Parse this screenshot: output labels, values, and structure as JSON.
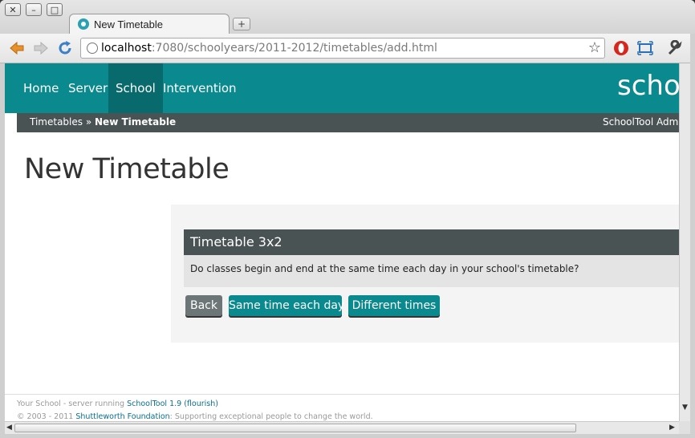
{
  "browser": {
    "tab_title": "New Timetable",
    "new_tab_label": "+",
    "window_controls": {
      "close": "✕",
      "minimize": "–",
      "maximize": "□"
    },
    "url_host": "localhost",
    "url_rest": ":7080/schoolyears/2011-2012/timetables/add.html"
  },
  "nav": {
    "items": [
      {
        "label": "Home"
      },
      {
        "label": "Server"
      },
      {
        "label": "School"
      },
      {
        "label": "Intervention"
      }
    ],
    "active": "School",
    "brand": "schoo",
    "accent_color": "#0a8a8f"
  },
  "breadcrumb": {
    "parent": "Timetables",
    "separator": "»",
    "current": "New Timetable",
    "user": "SchoolTool Administrator"
  },
  "page": {
    "title": "New Timetable"
  },
  "form": {
    "heading": "Timetable 3x2",
    "question": "Do classes begin and end at the same time each day in your school's timetable?",
    "buttons": {
      "back": "Back",
      "same": "Same time each day",
      "different": "Different times"
    }
  },
  "footer": {
    "line1_prefix": "Your School - server running ",
    "line1_link": "SchoolTool 1.9 (flourish)",
    "line2_prefix": "© 2003 - 2011 ",
    "line2_link": "Shuttleworth Foundation",
    "line2_suffix": ": Supporting exceptional people to change the world."
  }
}
